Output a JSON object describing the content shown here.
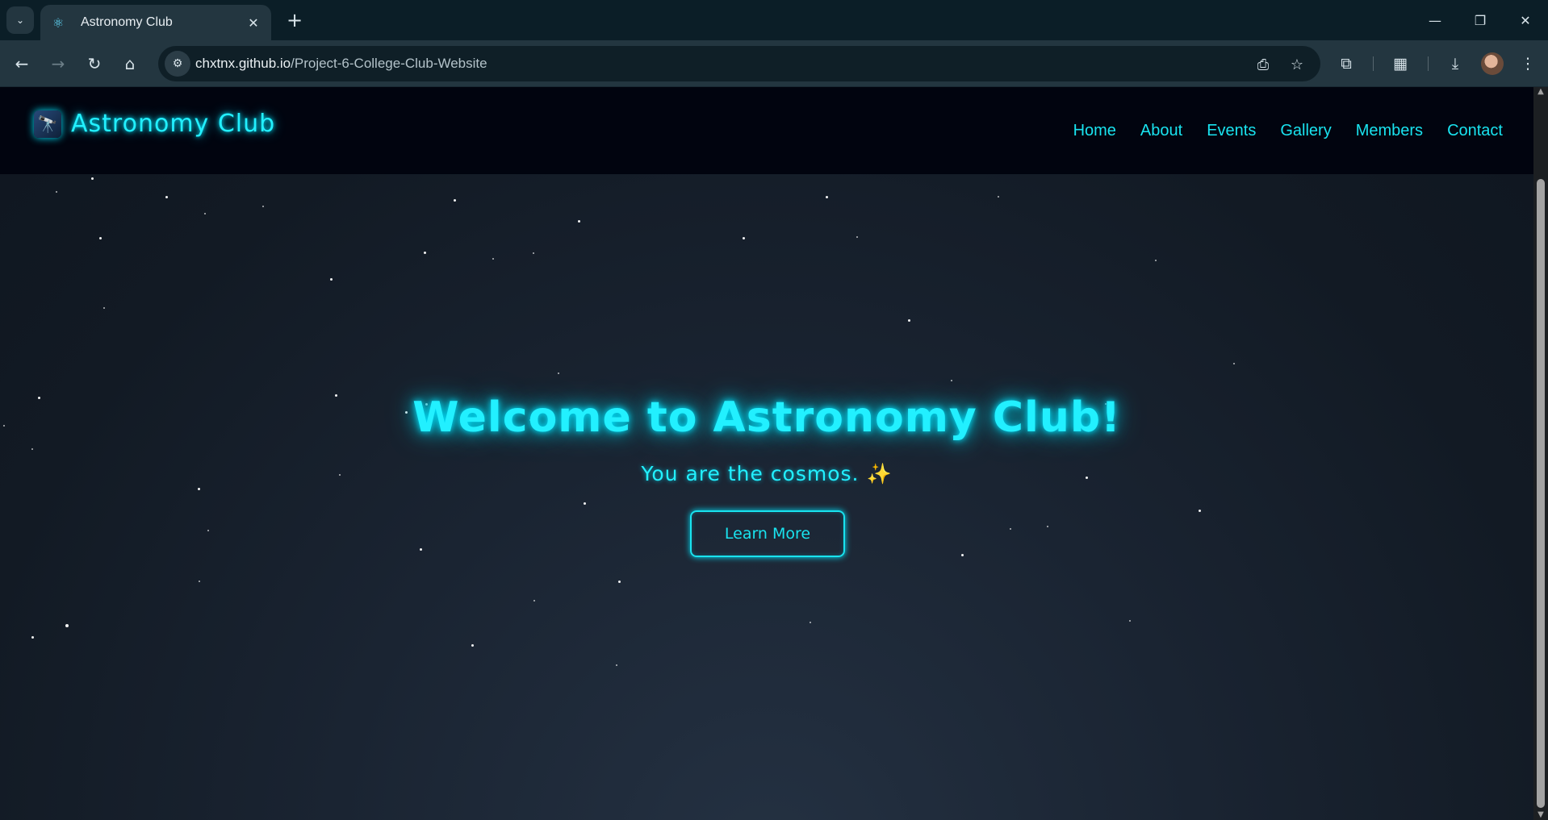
{
  "browser": {
    "tab_title": "Astronomy Club",
    "url_host": "chxtnx.github.io",
    "url_path": "/Project-6-College-Club-Website"
  },
  "site": {
    "logo_text": "Astronomy Club",
    "logo_emoji": "🔭",
    "nav": [
      "Home",
      "About",
      "Events",
      "Gallery",
      "Members",
      "Contact"
    ]
  },
  "hero": {
    "title": "Welcome to Astronomy Club!",
    "subtitle": "You are the cosmos.",
    "subtitle_emoji": "✨",
    "button": "Learn More"
  },
  "colors": {
    "accent": "#22f0ff",
    "header_bg": "#01040f",
    "page_bg": "#121a24",
    "chrome_bg": "#233640"
  },
  "icons": {
    "tab_list": "chevron-down-icon",
    "favicon": "react-atom-icon",
    "back": "back-arrow-icon",
    "forward": "forward-arrow-icon",
    "reload": "reload-icon",
    "home": "home-icon",
    "install": "install-app-icon",
    "bookmark": "star-icon",
    "extensions": "puzzle-icon",
    "qr": "qr-code-icon",
    "downloads": "download-icon",
    "menu": "kebab-menu-icon"
  }
}
